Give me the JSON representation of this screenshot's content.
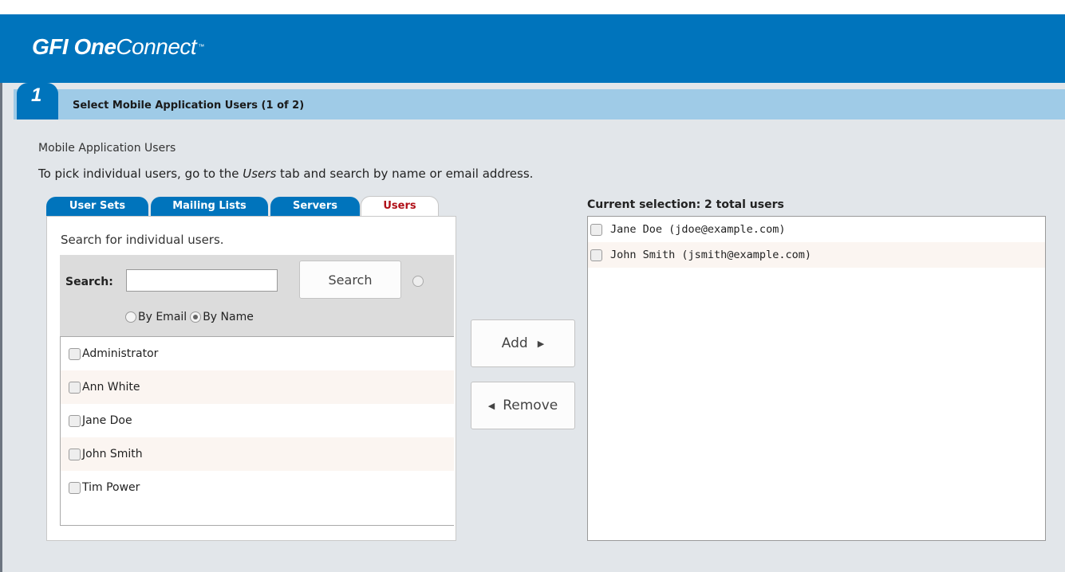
{
  "brand": {
    "gfi": "GFI",
    "one": "One",
    "connect": "Connect",
    "tm": "™"
  },
  "step": {
    "number": "1",
    "title": "Select Mobile Application Users (1 of 2)"
  },
  "section_label": "Mobile Application Users",
  "instructions": {
    "pre": "To pick individual users, go to the ",
    "em": "Users",
    "post": " tab and search by name or email address."
  },
  "tabs": [
    {
      "label": "User Sets"
    },
    {
      "label": "Mailing Lists"
    },
    {
      "label": "Servers"
    },
    {
      "label": "Users",
      "active": true
    }
  ],
  "search": {
    "hint": "Search for individual users.",
    "label": "Search:",
    "value": "",
    "button": "Search",
    "by_email": "By Email",
    "by_name": "By Name",
    "selected_mode": "By Name"
  },
  "users": [
    "Administrator",
    "Ann White",
    "Jane Doe",
    "John Smith",
    "Tim Power"
  ],
  "actions": {
    "add": "Add",
    "remove": "Remove"
  },
  "selection": {
    "title": "Current selection: 2 total users",
    "items": [
      "Jane Doe (jdoe@example.com)",
      "John Smith (jsmith@example.com)"
    ]
  },
  "colors": {
    "header": "#0074bc",
    "step_bar": "#9fcbe7",
    "active_tab_text": "#b01018",
    "content_bg": "#e2e6ea"
  }
}
